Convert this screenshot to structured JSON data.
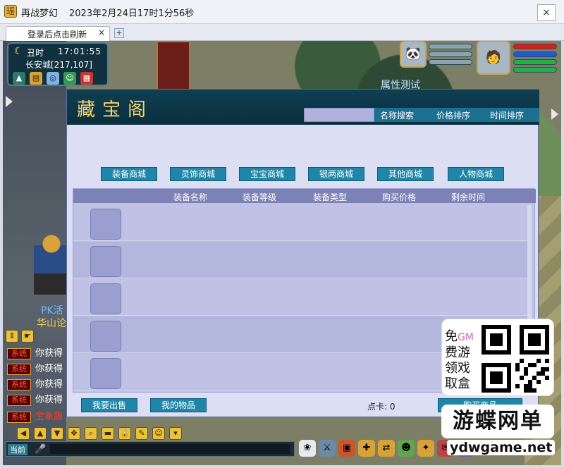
{
  "window": {
    "app_icon": "瑶",
    "title": "再战梦幻",
    "clock": "2023年2月24日17时1分56秒",
    "close": "×"
  },
  "tabs": [
    {
      "label": "登录后点击刷新",
      "close": "×"
    }
  ],
  "tab_new": "+",
  "game": {
    "shichen": "丑时",
    "time": "17:01:55",
    "location": "长安城[217,107]",
    "prop_test": "属性测试",
    "pk_label": "PK活",
    "huashan_label": "华山论",
    "colors": {
      "hp": "#d81e1e",
      "mp": "#1e5ad8",
      "exp": "#22b04a"
    }
  },
  "treasure": {
    "title": "藏宝阁",
    "sorts": [
      "名称搜索",
      "价格排序",
      "时间排序"
    ],
    "categories": [
      "装备商城",
      "灵饰商城",
      "宝宝商城",
      "银两商城",
      "其他商城",
      "人物商城"
    ],
    "columns": [
      "装备名称",
      "装备等级",
      "装备类型",
      "购买价格",
      "剩余时间"
    ],
    "footer": {
      "sell": "我要出售",
      "mine": "我的物品",
      "points": "点卡: 0",
      "buy": "购买商品"
    }
  },
  "chat": [
    {
      "badge": "系统",
      "text": "你获得"
    },
    {
      "badge": "系统",
      "text": "你获得"
    },
    {
      "badge": "系统",
      "text": "你获得"
    },
    {
      "badge": "系统",
      "text": "你获得"
    },
    {
      "badge": "系统",
      "text": "宝象跟"
    }
  ],
  "input_label": "当前",
  "watermark": {
    "lines": [
      "免",
      "费游",
      "领戏",
      "取盒"
    ],
    "gm": "GM",
    "brand": "游蝶网单",
    "url": "ydwgame.net"
  }
}
